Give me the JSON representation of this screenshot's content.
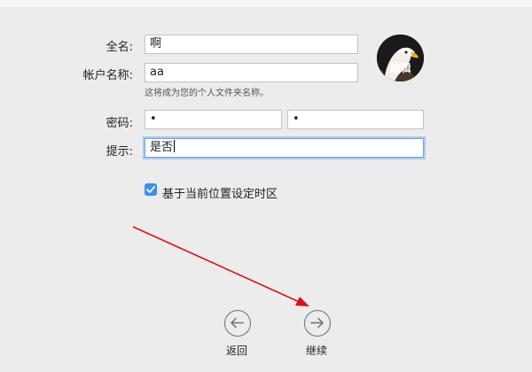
{
  "form": {
    "fullname_label": "全名:",
    "fullname_value": "啊",
    "account_label": "帐户名称:",
    "account_value": "aa",
    "account_hint": "这将成为您的个人文件夹名称。",
    "password_label": "密码:",
    "password_value": "•",
    "verify_value": "•",
    "hint_label": "提示:",
    "hint_value": "是否"
  },
  "avatar": {
    "edit_label": "编辑"
  },
  "timezone": {
    "checked": true,
    "label": "基于当前位置设定时区"
  },
  "nav": {
    "back_label": "返回",
    "continue_label": "继续"
  },
  "colors": {
    "checkbox": "#3d8ef0",
    "focus_ring": "#a9c8f2",
    "annotation_arrow": "#e01010"
  }
}
